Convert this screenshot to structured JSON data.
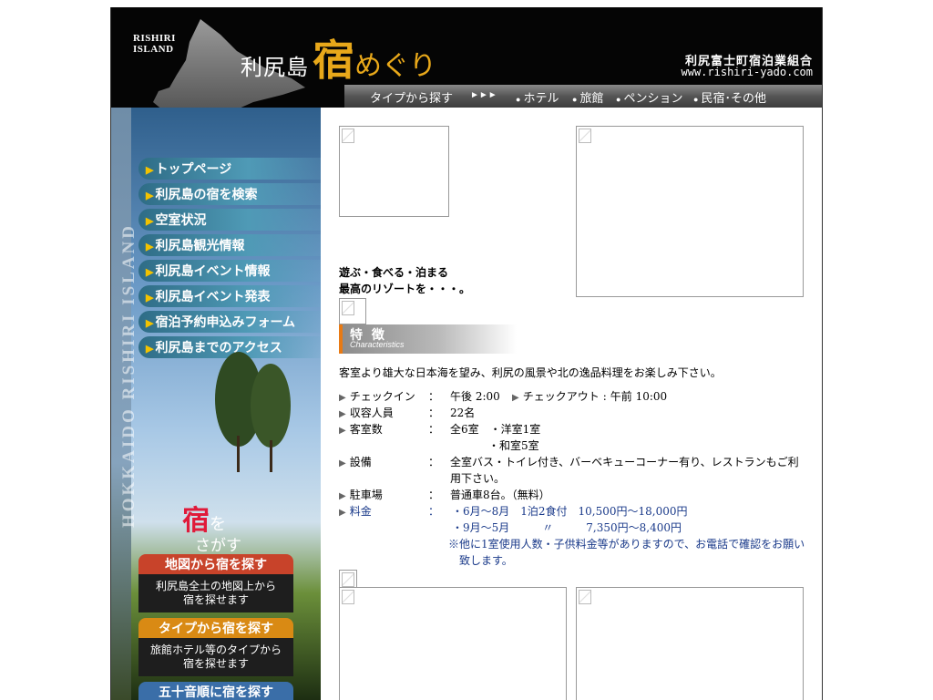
{
  "header": {
    "logo_line1": "RISHIRI",
    "logo_line2": "ISLAND",
    "title_part1": "利尻島",
    "title_part2": "宿",
    "title_part3": "めぐり",
    "union_name": "利尻富士町宿泊業組合",
    "union_url": "www.rishiri-yado.com"
  },
  "type_bar": {
    "label": "タイプから探す",
    "arrows": "►►►",
    "items": [
      "ホテル",
      "旅館",
      "ペンション",
      "民宿･その他"
    ]
  },
  "sidebar": {
    "vertical_text": "HOKKAIDO RISHIRI ISLAND",
    "nav": [
      "トップページ",
      "利尻島の宿を検索",
      "空室状況",
      "利尻島観光情報",
      "利尻島イベント情報",
      "利尻島イベント発表",
      "宿泊予約申込みフォーム",
      "利尻島までのアクセス"
    ],
    "search_logo_big": "宿",
    "search_logo_wo": "を",
    "search_logo_sub": "さがす",
    "buttons": [
      {
        "title": "地図から宿を探す",
        "line1": "利尻島全土の地図上から",
        "line2": "宿を探せます",
        "color": "#c8432a"
      },
      {
        "title": "タイプから宿を探す",
        "line1": "旅館ホテル等のタイプから",
        "line2": "宿を探せます",
        "color": "#d98a14"
      },
      {
        "title": "五十音順に宿を探す",
        "color": "#3a6ea8"
      }
    ]
  },
  "main": {
    "catch_line1": "遊ぶ・食べる・泊まる",
    "catch_line2": "最高のリゾートを・・・。",
    "section_title": "特 徴",
    "section_sub": "Characteristics",
    "description": "客室より雄大な日本海を望み、利尻の風景や北の逸品料理をお楽しみ下さい。",
    "colon": "：",
    "checkin_label": "チェックイン",
    "checkin_value": "午後 2:00",
    "checkout_label": "チェックアウト",
    "checkout_value": "午前 10:00",
    "capacity_label": "収容人員",
    "capacity_value": "22名",
    "rooms_label": "客室数",
    "rooms_value1": "全6室　・洋室1室",
    "rooms_value2": "・和室5室",
    "facility_label": "設備",
    "facility_value": "全室バス・トイレ付き、バーベキューコーナー有り、レストランもご利用下さい。",
    "parking_label": "駐車場",
    "parking_value": "普通車8台。（無料）",
    "price_label": "料金",
    "price_line1": "・6月〜8月　1泊2食付　10,500円〜18,000円",
    "price_line2": "・9月〜5月　　　〃　　　7,350円〜8,400円",
    "price_note": "※他に1室使用人数・子供料金等がありますので、お電話で確認をお願い致します。"
  }
}
